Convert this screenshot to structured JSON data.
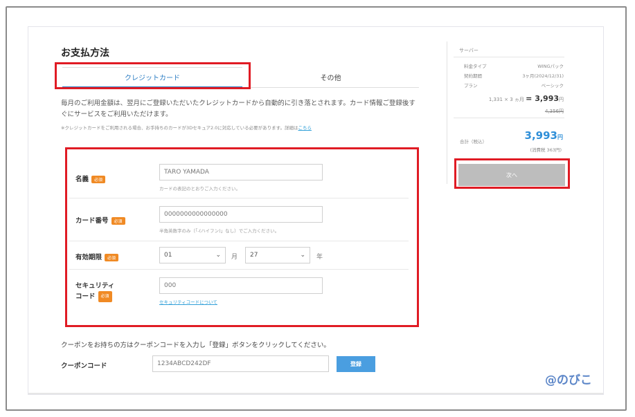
{
  "page": {
    "title": "お支払方法"
  },
  "tabs": [
    {
      "label": "クレジットカード",
      "active": true
    },
    {
      "label": "その他",
      "active": false
    }
  ],
  "description": "毎月のご利用金額は、翌月にご登録いただいたクレジットカードから自動的に引き落とされます。カード情報ご登録後すぐにサービスをご利用いただけます。",
  "note": {
    "text": "※クレジットカードをご利用される場合、お手持ちのカードが3Dセキュア2.0に対応している必要があります。詳細は",
    "link": "こちら"
  },
  "required_badge": "必須",
  "form": {
    "name": {
      "label": "名義",
      "value": "TARO YAMADA",
      "hint": "カードの表記のとおりご入力ください。"
    },
    "card_number": {
      "label": "カード番号",
      "value": "0000000000000000",
      "hint": "半角英数字のみ（「-(ハイフン)」なし）でご入力ください。"
    },
    "expiry": {
      "label": "有効期限",
      "month": "01",
      "month_unit": "月",
      "year": "27",
      "year_unit": "年"
    },
    "security": {
      "label_line1": "セキュリティ",
      "label_line2": "コード",
      "value": "000",
      "link": "セキュリティコードについて"
    }
  },
  "coupon": {
    "description": "クーポンをお持ちの方はクーポンコードを入力し「登録」ボタンをクリックしてください。",
    "label": "クーポンコード",
    "value": "1234ABCD242DF",
    "button": "登録"
  },
  "summary": {
    "title": "サーバー",
    "rows": [
      {
        "key": "料金タイプ",
        "value": "WINGパック"
      },
      {
        "key": "契約期間",
        "value": "3ヶ月(2024/12/31)"
      },
      {
        "key": "プラン",
        "value": "ベーシック"
      }
    ],
    "calc_prefix": "1,331 × 3 ヵ月",
    "calc_amount": "= 3,993",
    "calc_currency": "円",
    "strike_price": "4,356円",
    "total_label": "合計（税込）",
    "total_amount": "3,993",
    "total_currency": "円",
    "tax": "(消費税 363円)",
    "next_button": "次へ"
  },
  "watermark": "@のびこ",
  "colors": {
    "accent": "#2f7fc4",
    "highlight": "#e01b24",
    "required": "#f08a24",
    "button": "#4a9ee0",
    "disabled": "#bdbdbd"
  }
}
